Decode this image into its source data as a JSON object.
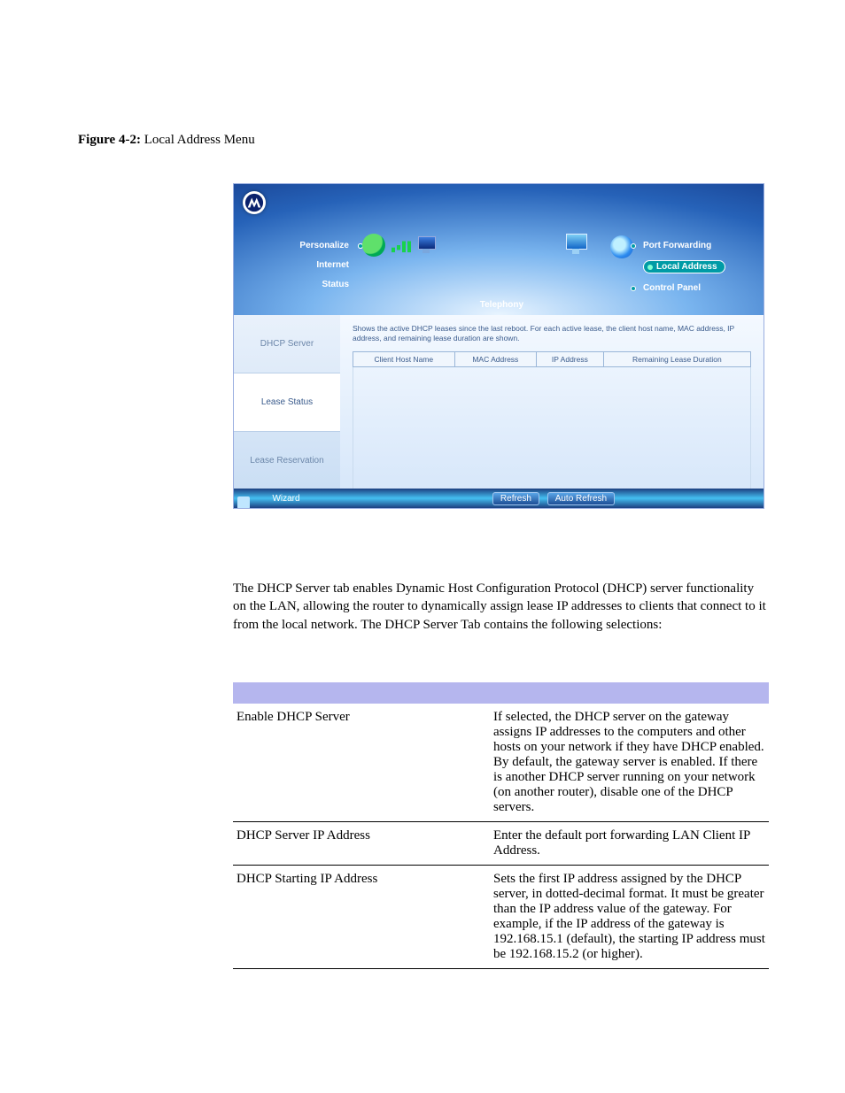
{
  "figure": {
    "label": "Figure 4-2:",
    "title": "Local Address Menu"
  },
  "ui": {
    "left_menu": [
      "Personalize",
      "Internet",
      "Status"
    ],
    "right_menu": {
      "items": [
        "Port Forwarding",
        "Local Address",
        "Control Panel"
      ],
      "active_index": 1
    },
    "center_label": "Telephony",
    "side_tabs": {
      "items": [
        "DHCP Server",
        "Lease Status",
        "Lease Reservation"
      ],
      "active_index": 1
    },
    "lease": {
      "description": "Shows the active DHCP leases since the last reboot. For each active lease, the client host name, MAC address, IP address, and remaining lease duration are shown.",
      "columns": [
        "Client Host Name",
        "MAC Address",
        "IP Address",
        "Remaining Lease Duration"
      ]
    },
    "footer": {
      "wizard": "Wizard",
      "refresh": "Refresh",
      "auto_refresh": "Auto Refresh"
    }
  },
  "paragraph": "The DHCP Server tab enables Dynamic Host Configuration Protocol (DHCP) server functionality on the LAN, allowing the router to dynamically assign lease IP addresses to clients that connect to it from the local network. The DHCP Server Tab contains the following selections:",
  "table": {
    "rows": [
      {
        "field": "Enable DHCP Server",
        "desc": "If selected, the DHCP server on the gateway assigns IP addresses to the computers and other hosts on your network if they have DHCP enabled. By default, the gateway server is enabled. If there is another DHCP server running on your network (on another router), disable one of the DHCP servers."
      },
      {
        "field": "DHCP Server IP Address",
        "desc": "Enter the default port forwarding LAN Client IP Address."
      },
      {
        "field": "DHCP Starting IP Address",
        "desc": "Sets the first IP address assigned by the DHCP server, in dotted-decimal format. It must be greater than the IP address value of the gateway. For example, if the IP address of the gateway is 192.168.15.1 (default), the starting IP address must be 192.168.15.2 (or higher)."
      }
    ]
  }
}
